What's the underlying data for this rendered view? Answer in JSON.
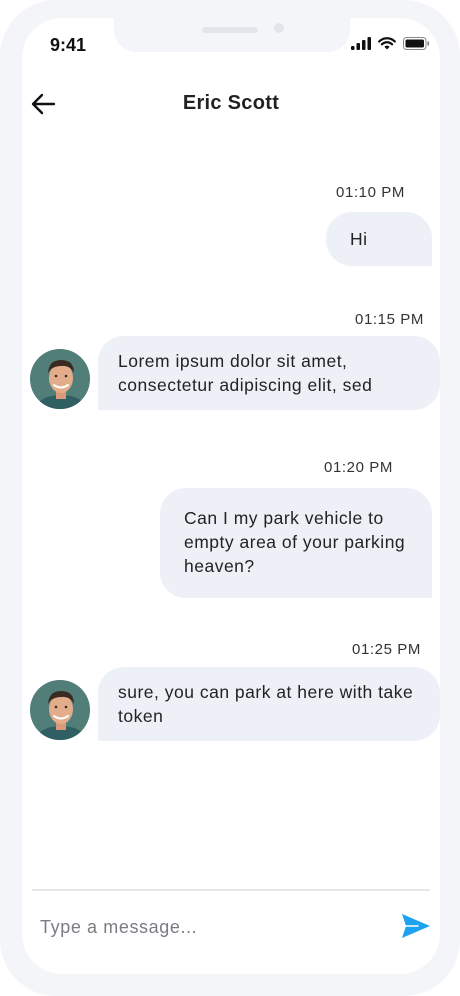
{
  "status_bar": {
    "time": "9:41"
  },
  "header": {
    "contact_name": "Eric Scott"
  },
  "messages": [
    {
      "time": "01:10 PM",
      "text": "Hi",
      "direction": "outgoing"
    },
    {
      "time": "01:15 PM",
      "text": "Lorem ipsum dolor sit amet, consectetur adipiscing elit, sed",
      "direction": "incoming"
    },
    {
      "time": "01:20 PM",
      "text": "Can I my park vehicle to empty area of your parking heaven?",
      "direction": "outgoing"
    },
    {
      "time": "01:25 PM",
      "text": "sure, you can park at here with take token",
      "direction": "incoming"
    }
  ],
  "composer": {
    "placeholder": "Type a message..."
  },
  "icons": {
    "back": "arrow-left-icon",
    "send": "send-icon",
    "signal": "cellular-signal-icon",
    "wifi": "wifi-icon",
    "battery": "battery-icon"
  },
  "colors": {
    "bubble": "#eef0f8",
    "send_accent": "#1da1f2",
    "text": "#222222"
  }
}
